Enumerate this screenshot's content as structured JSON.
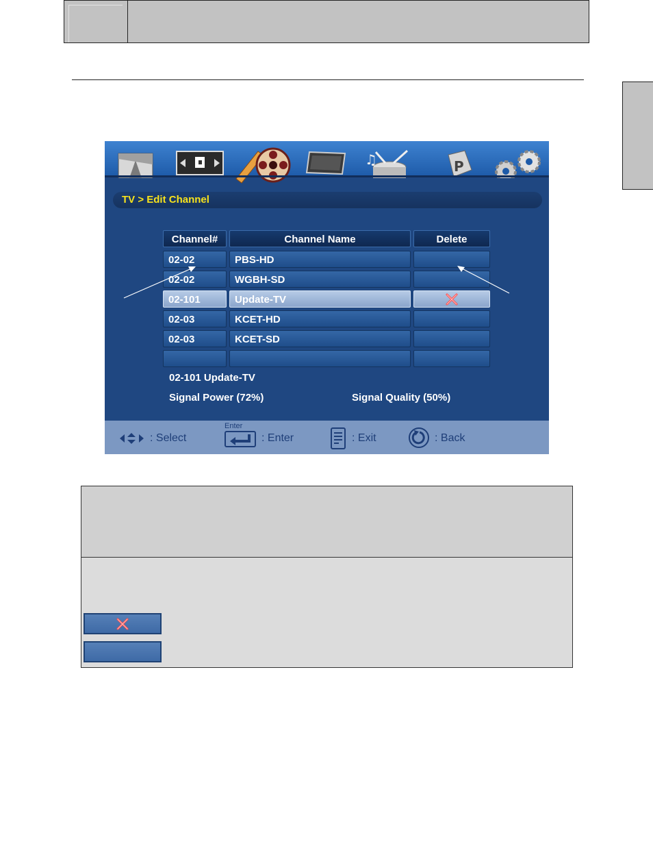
{
  "menu": {
    "tabs": [
      {
        "name": "picture-tab",
        "icon": "picture-icon"
      },
      {
        "name": "aspect-tab",
        "icon": "aspect-ratio-icon"
      },
      {
        "name": "tv-tab",
        "icon": "film-reel-icon",
        "active": true
      },
      {
        "name": "display-tab",
        "icon": "monitor-icon"
      },
      {
        "name": "audio-tab",
        "icon": "music-drum-icon"
      },
      {
        "name": "parental-tab",
        "icon": "parental-lock-icon"
      },
      {
        "name": "setup-tab",
        "icon": "gears-icon"
      }
    ],
    "breadcrumb": "TV > Edit Channel",
    "table": {
      "headers": [
        "Channel#",
        "Channel Name",
        "Delete"
      ],
      "rows": [
        {
          "channel": "02-02",
          "name": "PBS-HD",
          "delete": false
        },
        {
          "channel": "02-02",
          "name": "WGBH-SD",
          "delete": false
        },
        {
          "channel": "02-101",
          "name": "Update-TV",
          "delete": true,
          "selected": true
        },
        {
          "channel": "02-03",
          "name": "KCET-HD",
          "delete": false
        },
        {
          "channel": "02-03",
          "name": "KCET-SD",
          "delete": false
        },
        {
          "channel": "",
          "name": "",
          "delete": false
        }
      ]
    },
    "current_channel": "02-101 Update-TV",
    "signal_power": "Signal Power (72%)",
    "signal_quality": "Signal Quality (50%)",
    "footer": {
      "select": ": Select",
      "enter_key_label": "Enter",
      "enter": ": Enter",
      "exit": ": Exit",
      "back": ": Back"
    }
  },
  "colors": {
    "screen_bg": "#1f4781",
    "breadcrumb_text": "#f6e21c",
    "footer_bg": "#7c98c2",
    "delete_mark": "#ff4a4a"
  }
}
